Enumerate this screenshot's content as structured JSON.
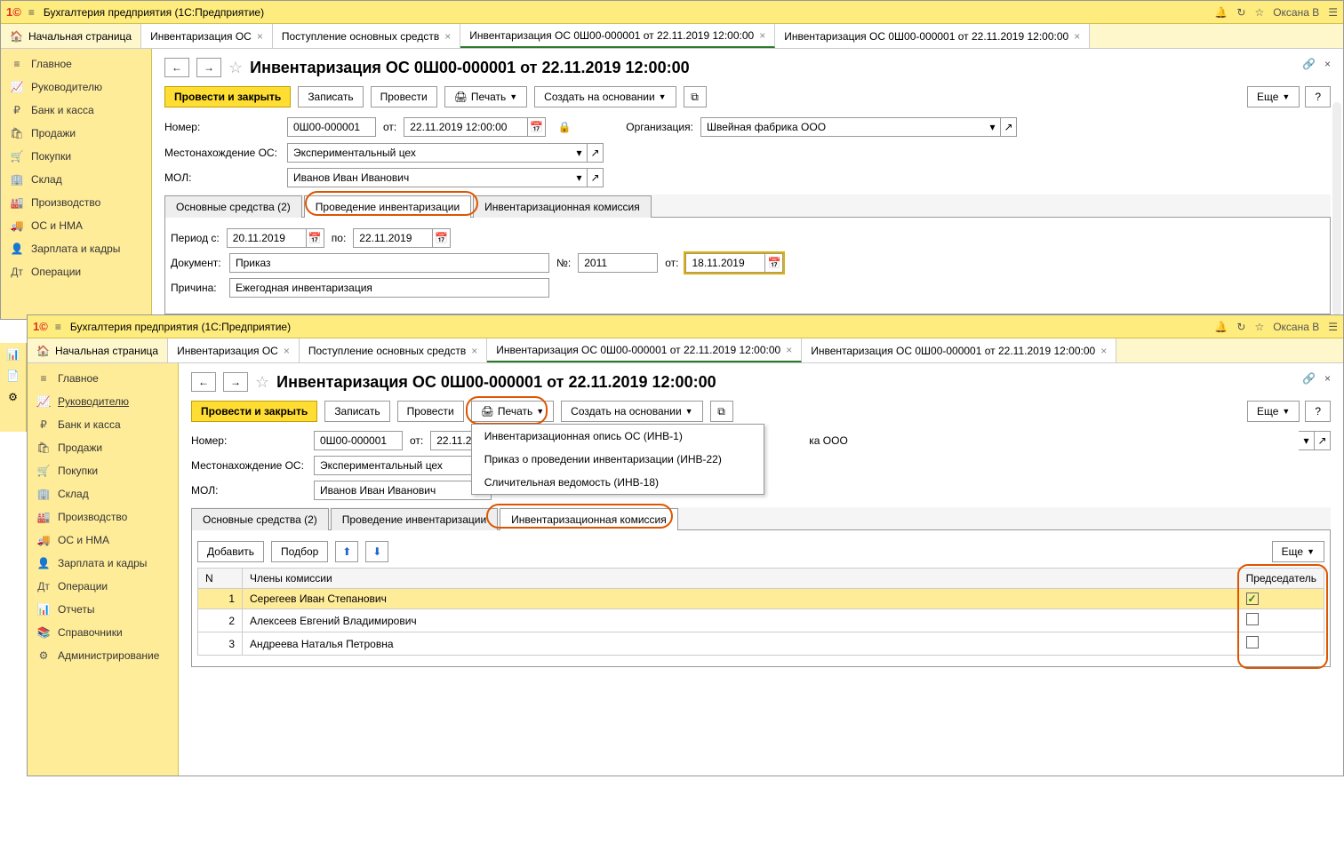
{
  "app_title": "Бухгалтерия предприятия  (1С:Предприятие)",
  "user": "Оксана В",
  "tabs_top": {
    "home": "Начальная страница",
    "t1": "Инвентаризация ОС",
    "t2": "Поступление основных средств",
    "t3": "Инвентаризация ОС 0Ш00-000001 от 22.11.2019 12:00:00",
    "t4": "Инвентаризация ОС 0Ш00-000001 от 22.11.2019 12:00:00"
  },
  "sidebar": [
    {
      "label": "Главное",
      "icon": "≡"
    },
    {
      "label": "Руководителю",
      "icon": "📈"
    },
    {
      "label": "Банк и касса",
      "icon": "₽"
    },
    {
      "label": "Продажи",
      "icon": "🛍"
    },
    {
      "label": "Покупки",
      "icon": "🛒"
    },
    {
      "label": "Склад",
      "icon": "🏢"
    },
    {
      "label": "Производство",
      "icon": "🏭"
    },
    {
      "label": "ОС и НМА",
      "icon": "🚚"
    },
    {
      "label": "Зарплата и кадры",
      "icon": "👤"
    },
    {
      "label": "Операции",
      "icon": "Дт"
    },
    {
      "label": "Отчеты",
      "icon": "📊"
    },
    {
      "label": "Справочники",
      "icon": "📚"
    },
    {
      "label": "Администрирование",
      "icon": "⚙"
    }
  ],
  "left_tools": [
    "📊",
    "📄",
    "⚙"
  ],
  "page_title": "Инвентаризация ОС 0Ш00-000001 от 22.11.2019 12:00:00",
  "toolbar": {
    "post_close": "Провести и закрыть",
    "write": "Записать",
    "post": "Провести",
    "print": "Печать",
    "create_based": "Создать на основании",
    "more": "Еще",
    "help": "?"
  },
  "form": {
    "number_label": "Номер:",
    "number": "0Ш00-000001",
    "from_label": "от:",
    "date": "22.11.2019 12:00:00",
    "date_short": "22.11.2019",
    "org_label": "Организация:",
    "org": "Швейная фабрика ООО",
    "loc_label": "Местонахождение ОС:",
    "loc": "Экспериментальный цех",
    "mol_label": "МОЛ:",
    "mol": "Иванов Иван Иванович"
  },
  "inner_tabs": {
    "a": "Основные средства (2)",
    "b": "Проведение инвентаризации",
    "c": "Инвентаризационная комиссия"
  },
  "panel_b": {
    "period_from": "Период с:",
    "date1": "20.11.2019",
    "to": "по:",
    "date2": "22.11.2019",
    "doc_label": "Документ:",
    "doc": "Приказ",
    "num_label": "№:",
    "num": "2011",
    "from2": "от:",
    "date3": "18.11.2019",
    "reason_label": "Причина:",
    "reason": "Ежегодная инвентаризация"
  },
  "print_menu": [
    "Инвентаризационная опись ОС (ИНВ-1)",
    "Приказ о проведении инвентаризации (ИНВ-22)",
    "Сличительная ведомость (ИНВ-18)"
  ],
  "panel_c": {
    "add": "Добавить",
    "pick": "Подбор",
    "more": "Еще",
    "col_n": "N",
    "col_member": "Члены комиссии",
    "col_chair": "Председатель",
    "rows": [
      {
        "n": "1",
        "name": "Серегеев Иван Степанович",
        "chair": true
      },
      {
        "n": "2",
        "name": "Алексеев Евгений Владимирович",
        "chair": false
      },
      {
        "n": "3",
        "name": "Андреева Наталья Петровна",
        "chair": false
      }
    ]
  }
}
